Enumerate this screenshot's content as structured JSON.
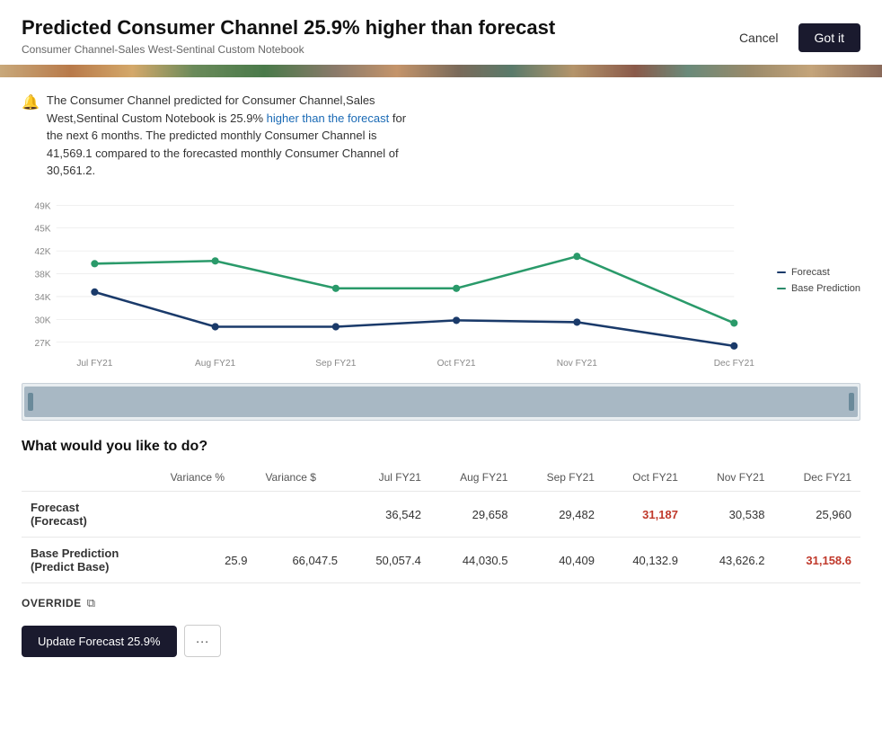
{
  "header": {
    "title": "Predicted Consumer Channel 25.9% higher than forecast",
    "subtitle": "Consumer Channel-Sales West-Sentinal Custom Notebook",
    "cancel_label": "Cancel",
    "got_it_label": "Got it"
  },
  "info": {
    "text_before": "The Consumer Channel predicted for Consumer Channel,Sales West,Sentinal Custom Notebook is 25.9%",
    "highlight": "higher than the forecast",
    "text_after": "for the next 6 months. The predicted monthly Consumer Channel is 41,569.1 compared to the forecasted monthly Consumer Channel of 30,561.2."
  },
  "chart": {
    "y_labels": [
      "49K",
      "45K",
      "42K",
      "38K",
      "34K",
      "30K",
      "27K"
    ],
    "x_labels": [
      "Jul FY21",
      "Aug FY21",
      "Sep FY21",
      "Oct FY21",
      "Nov FY21",
      "Dec FY21"
    ],
    "legend": {
      "forecast_label": "Forecast",
      "base_label": "Base Prediction"
    }
  },
  "what_section": {
    "title": "What would you like to do?"
  },
  "table": {
    "columns": [
      "",
      "Variance %",
      "Variance $",
      "Jul FY21",
      "Aug FY21",
      "Sep FY21",
      "Oct FY21",
      "Nov FY21",
      "Dec FY21"
    ],
    "rows": [
      {
        "label": "Forecast\n(Forecast)",
        "variance_pct": "",
        "variance_dollar": "",
        "jul": "36,542",
        "aug": "29,658",
        "sep": "29,482",
        "oct": "31,187",
        "nov": "30,538",
        "dec": "25,960",
        "oct_highlight": true
      },
      {
        "label": "Base Prediction\n(Predict Base)",
        "variance_pct": "25.9",
        "variance_dollar": "66,047.5",
        "jul": "50,057.4",
        "aug": "44,030.5",
        "sep": "40,409",
        "oct": "40,132.9",
        "nov": "43,626.2",
        "dec": "31,158.6",
        "dec_highlight": true
      }
    ]
  },
  "override": {
    "label": "OVERRIDE"
  },
  "actions": {
    "update_label": "Update Forecast 25.9%",
    "more_label": "···"
  }
}
